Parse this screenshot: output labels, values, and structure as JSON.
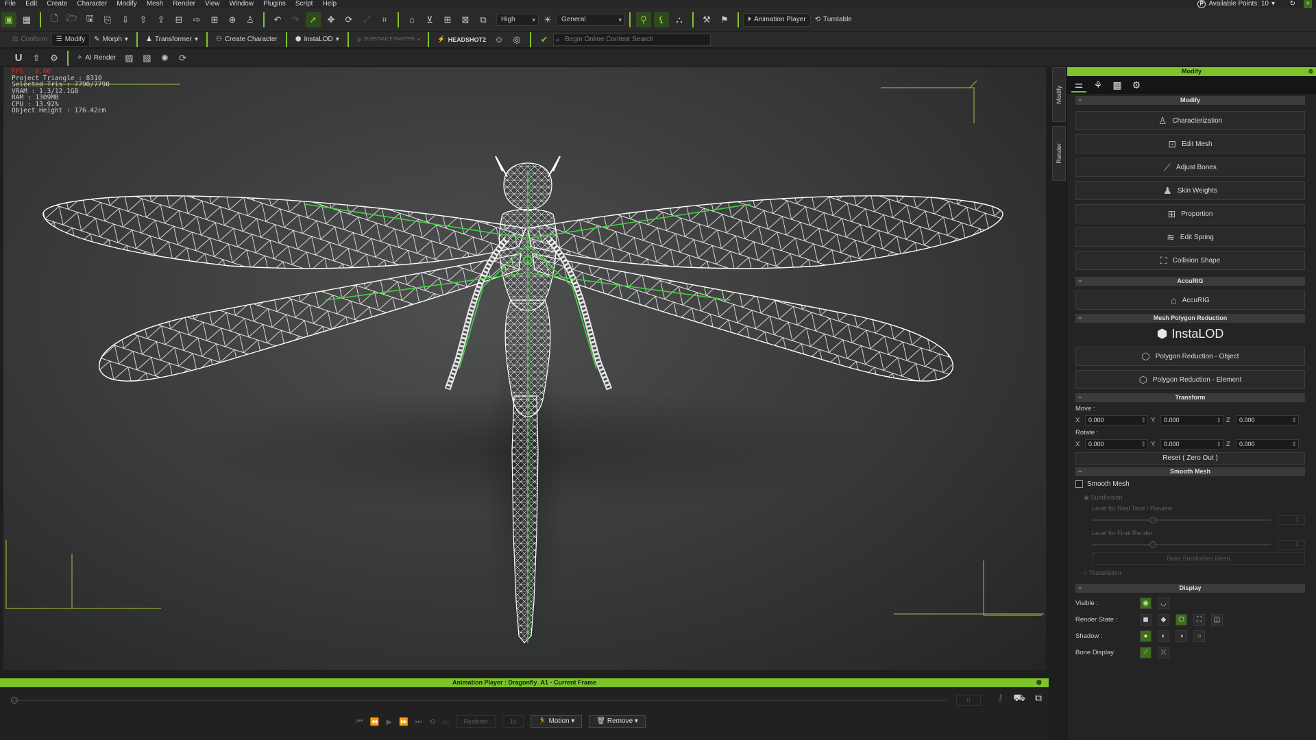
{
  "menubar": {
    "items": [
      "File",
      "Edit",
      "Create",
      "Character",
      "Modify",
      "Mesh",
      "Render",
      "View",
      "Window",
      "Plugins",
      "Script",
      "Help"
    ],
    "available_points": "Available Points: 10"
  },
  "toolbar": {
    "quality": "High",
    "preset": "General",
    "animation_player": "Animation Player",
    "turntable": "Turntable",
    "conform": "Conform",
    "modify": "Modify",
    "morph": "Morph",
    "transformer": "Transformer",
    "create_character": "Create Character",
    "instalod": "InstaLOD",
    "substance": "SUBSTANCE PAINTER",
    "headshot": "HEADSHOT2",
    "search_placeholder": "Begin Online Content Search",
    "ai_render": "AI Render"
  },
  "stats": {
    "fps": "FPS : 0.00",
    "project_triangle": "Project Triangle : 8310",
    "selected_tris": "Selected Tris : 7790/7790",
    "vram": "VRAM : 1.3/12.1GB",
    "ram": "RAM : 1309MB",
    "cpu": "CPU : 13.92%",
    "object_height": "Object Height : 176.42cm"
  },
  "side_tabs": [
    "Modify",
    "Render"
  ],
  "panel": {
    "title": "Modify",
    "sections": {
      "modify": "Modify",
      "accurig": "AccuRIG",
      "mesh_reduction": "Mesh Polygon Reduction",
      "transform": "Transform",
      "smooth_mesh": "Smooth Mesh",
      "display": "Display"
    },
    "modify_buttons": [
      "Characterization",
      "Edit Mesh",
      "Adjust Bones",
      "Skin Weights",
      "Proportion",
      "Edit Spring",
      "Collision Shape"
    ],
    "accurig_button": "AccuRIG",
    "instalod_logo": "InstaLOD",
    "reduction_buttons": [
      "Polygon Reduction - Object",
      "Polygon Reduction - Element"
    ],
    "move_label": "Move :",
    "rotate_label": "Rotate :",
    "move": {
      "x": "0.000",
      "y": "0.000",
      "z": "0.000"
    },
    "rotate": {
      "x": "0.000",
      "y": "0.000",
      "z": "0.000"
    },
    "reset": "Reset ( Zero Out )",
    "smooth_mesh_check": "Smooth Mesh",
    "subdivision": "Subdivision",
    "level_realtime": "Level for Real Time / Preview",
    "level_final": "Level for Final Render",
    "level_realtime_value": "1",
    "level_final_value": "1",
    "bake_btn": "Bake Subdivided Mesh",
    "tessellation": "Tessellation",
    "display_rows": [
      "Visible :",
      "Render State :",
      "Shadow :",
      "Bone Display"
    ]
  },
  "anim": {
    "title": "Animation Player : Dragonfly_A1 - Current Frame",
    "frame": "0",
    "realtime": "Realtime",
    "speed": "1x",
    "motion": "Motion",
    "remove": "Remove"
  },
  "colors": {
    "accent": "#7cc427",
    "wireframe": "#ffffff",
    "bone": "#3fd33f"
  }
}
